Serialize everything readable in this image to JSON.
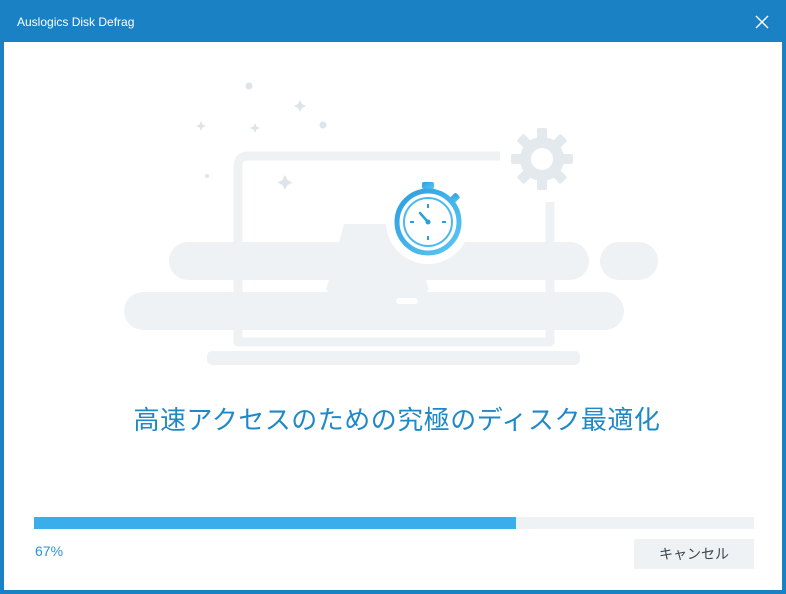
{
  "window": {
    "title": "Auslogics Disk Defrag"
  },
  "icons": {
    "close": "close-icon",
    "gear": "gear-icon",
    "stopwatch": "stopwatch-icon",
    "disk": "hard-disk-icon",
    "laptop": "laptop-icon"
  },
  "main": {
    "heading": "高速アクセスのための究極のディスク最適化"
  },
  "progress": {
    "value": 0.67,
    "label": "67%"
  },
  "buttons": {
    "cancel_label": "キャンセル"
  },
  "colors": {
    "titlebar": "#1a82c4",
    "accent": "#3aaeea",
    "heading": "#1f89c8",
    "illustration": "#eef2f5"
  }
}
